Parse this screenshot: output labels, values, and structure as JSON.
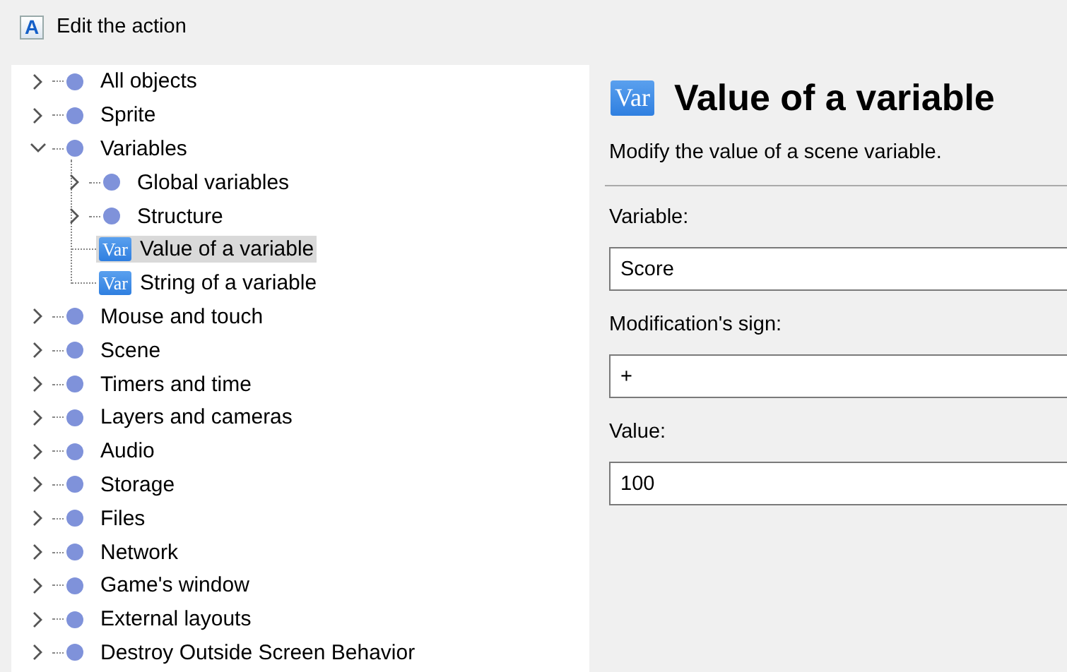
{
  "window": {
    "icon_letter": "A",
    "title": "Edit the action"
  },
  "tree": {
    "items": [
      {
        "kind": "category",
        "label": "All objects",
        "expanded": false,
        "selected": false
      },
      {
        "kind": "category",
        "label": "Sprite",
        "expanded": false,
        "selected": false
      },
      {
        "kind": "category",
        "label": "Variables",
        "expanded": true,
        "selected": false,
        "children": [
          {
            "kind": "category",
            "label": "Global variables",
            "expanded": false,
            "selected": false
          },
          {
            "kind": "category",
            "label": "Structure",
            "expanded": false,
            "selected": false
          },
          {
            "kind": "action",
            "icon_text": "Var",
            "label": "Value of a variable",
            "selected": true
          },
          {
            "kind": "action",
            "icon_text": "Var",
            "label": "String of a variable",
            "selected": false
          }
        ]
      },
      {
        "kind": "category",
        "label": "Mouse and touch",
        "expanded": false,
        "selected": false
      },
      {
        "kind": "category",
        "label": "Scene",
        "expanded": false,
        "selected": false
      },
      {
        "kind": "category",
        "label": "Timers and time",
        "expanded": false,
        "selected": false
      },
      {
        "kind": "category",
        "label": "Layers and cameras",
        "expanded": false,
        "selected": false
      },
      {
        "kind": "category",
        "label": "Audio",
        "expanded": false,
        "selected": false
      },
      {
        "kind": "category",
        "label": "Storage",
        "expanded": false,
        "selected": false
      },
      {
        "kind": "category",
        "label": "Files",
        "expanded": false,
        "selected": false
      },
      {
        "kind": "category",
        "label": "Network",
        "expanded": false,
        "selected": false
      },
      {
        "kind": "category",
        "label": "Game's window",
        "expanded": false,
        "selected": false
      },
      {
        "kind": "category",
        "label": "External layouts",
        "expanded": false,
        "selected": false
      },
      {
        "kind": "category",
        "label": "Destroy Outside Screen Behavior",
        "expanded": false,
        "selected": false
      }
    ]
  },
  "action": {
    "icon_text": "Var",
    "title": "Value of a variable",
    "description": "Modify the value of a scene variable.",
    "parameters": [
      {
        "label": "Variable:",
        "value": "Score"
      },
      {
        "label": "Modification's sign:",
        "value": "+"
      },
      {
        "label": "Value:",
        "value": "100"
      }
    ]
  }
}
